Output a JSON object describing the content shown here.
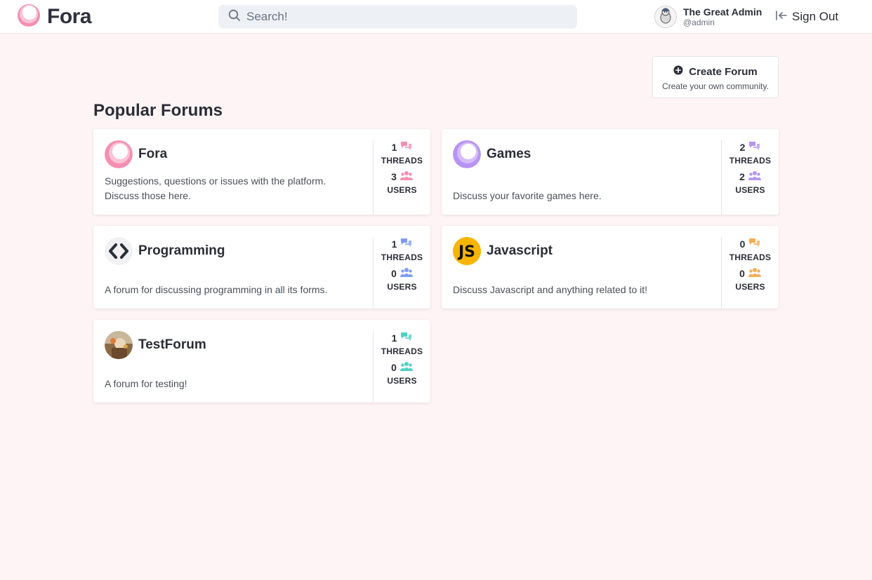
{
  "app": {
    "name": "Fora"
  },
  "search": {
    "placeholder": "Search!"
  },
  "user": {
    "display_name": "The Great Admin",
    "handle": "@admin"
  },
  "nav": {
    "sign_out_label": "Sign Out"
  },
  "create_forum": {
    "title": "Create Forum",
    "subtitle": "Create your own community."
  },
  "section": {
    "title": "Popular Forums"
  },
  "stat_labels": {
    "threads": "THREADS",
    "users": "USERS"
  },
  "colors": {
    "brand_pink": "#f48fb1",
    "games_purple": "#b794f4",
    "programming_blue": "#7f9cf5",
    "javascript_orange": "#f6ad55",
    "test_teal": "#4fd1c5",
    "background": "#fff4f5"
  },
  "forums": [
    {
      "name": "Fora",
      "description": "Suggestions, questions or issues with the platform. Discuss those here.",
      "threads": "1",
      "users": "3",
      "icon": "fora-logo-icon",
      "accent": "#f48fb1"
    },
    {
      "name": "Games",
      "description": "Discuss your favorite games here.",
      "threads": "2",
      "users": "2",
      "icon": "games-bubble-icon",
      "accent": "#b794f4"
    },
    {
      "name": "Programming",
      "description": "A forum for discussing programming in all its forms.",
      "threads": "1",
      "users": "0",
      "icon": "code-brackets-icon",
      "accent": "#7f9cf5"
    },
    {
      "name": "Javascript",
      "description": "Discuss Javascript and anything related to it!",
      "threads": "0",
      "users": "0",
      "icon": "js-logo-icon",
      "accent": "#f6ad55"
    },
    {
      "name": "TestForum",
      "description": "A forum for testing!",
      "threads": "1",
      "users": "0",
      "icon": "photo-avatar-icon",
      "accent": "#4fd1c5"
    }
  ]
}
